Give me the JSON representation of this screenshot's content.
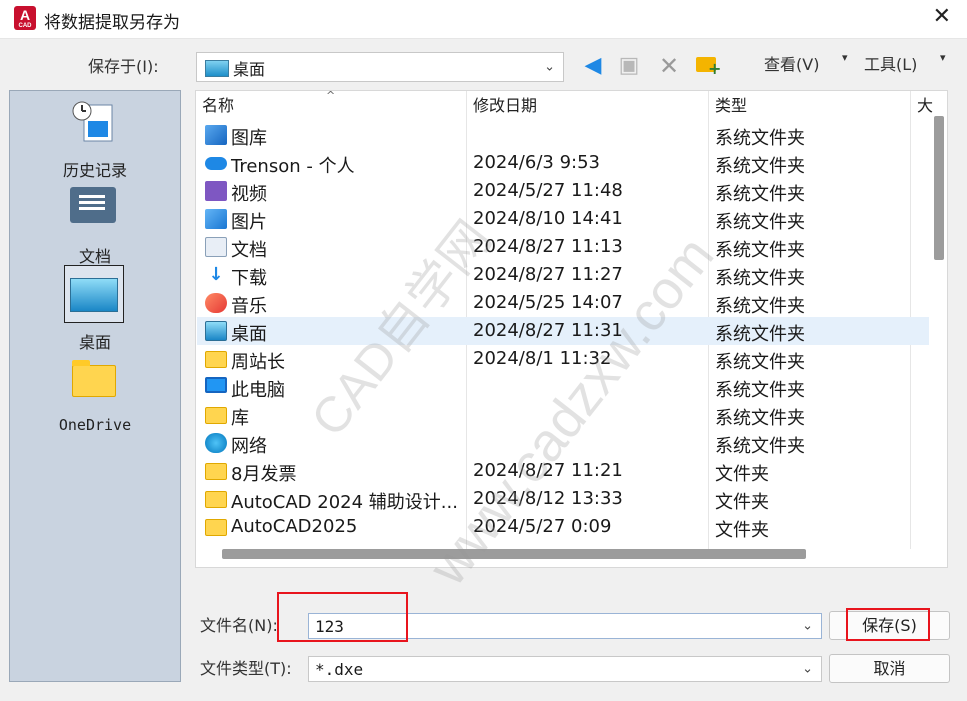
{
  "window": {
    "title": "将数据提取另存为",
    "icon_label": "A",
    "icon_sublabel": "CAD"
  },
  "toolbar": {
    "save_in_label": "保存于(I):",
    "save_in_value": "桌面",
    "view_label": "查看(V)",
    "tools_label": "工具(L)",
    "icons": [
      "back-arrow-icon",
      "up-folder-icon",
      "delete-icon",
      "new-folder-icon"
    ]
  },
  "places": [
    {
      "label": "历史记录",
      "icon": "history-icon"
    },
    {
      "label": "文档",
      "icon": "documents-icon"
    },
    {
      "label": "桌面",
      "icon": "desktop-icon",
      "selected": true
    },
    {
      "label": "OneDrive",
      "icon": "onedrive-folder-icon"
    }
  ],
  "columns": {
    "name": "名称",
    "date": "修改日期",
    "type": "类型",
    "extra": "大"
  },
  "files": [
    {
      "name": "图库",
      "date": "",
      "type": "系统文件夹",
      "icon": "gallery-icon"
    },
    {
      "name": "Trenson - 个人",
      "date": "2024/6/3 9:53",
      "type": "系统文件夹",
      "icon": "cloud-icon"
    },
    {
      "name": "视频",
      "date": "2024/5/27 11:48",
      "type": "系统文件夹",
      "icon": "video-icon"
    },
    {
      "name": "图片",
      "date": "2024/8/10 14:41",
      "type": "系统文件夹",
      "icon": "pictures-icon"
    },
    {
      "name": "文档",
      "date": "2024/8/27 11:13",
      "type": "系统文件夹",
      "icon": "document-icon"
    },
    {
      "name": "下载",
      "date": "2024/8/27 11:27",
      "type": "系统文件夹",
      "icon": "download-icon"
    },
    {
      "name": "音乐",
      "date": "2024/5/25 14:07",
      "type": "系统文件夹",
      "icon": "music-icon"
    },
    {
      "name": "桌面",
      "date": "2024/8/27 11:31",
      "type": "系统文件夹",
      "icon": "desktop-icon",
      "selected": true
    },
    {
      "name": "周站长",
      "date": "2024/8/1 11:32",
      "type": "系统文件夹",
      "icon": "folder-icon"
    },
    {
      "name": "此电脑",
      "date": "",
      "type": "系统文件夹",
      "icon": "computer-icon"
    },
    {
      "name": "库",
      "date": "",
      "type": "系统文件夹",
      "icon": "folder-icon"
    },
    {
      "name": "网络",
      "date": "",
      "type": "系统文件夹",
      "icon": "network-icon"
    },
    {
      "name": "8月发票",
      "date": "2024/8/27 11:21",
      "type": "文件夹",
      "icon": "folder-icon"
    },
    {
      "name": "AutoCAD 2024 辅助设计...",
      "date": "2024/8/12 13:33",
      "type": "文件夹",
      "icon": "folder-icon"
    },
    {
      "name": "AutoCAD2025",
      "date": "2024/5/27 0:09",
      "type": "文件夹",
      "icon": "folder-icon"
    }
  ],
  "form": {
    "filename_label": "文件名(N):",
    "filename_value": "123",
    "filetype_label": "文件类型(T):",
    "filetype_value": "*.dxe",
    "save_button": "保存(S)",
    "cancel_button": "取消"
  },
  "watermark": {
    "line1": "CAD自学网",
    "line2": "www.cadzxw.com"
  },
  "colors": {
    "highlight_box": "#e8141d",
    "selected_row": "#e5f0fb",
    "places_bg": "#c9d3e0",
    "accent": "#1e88e5"
  }
}
